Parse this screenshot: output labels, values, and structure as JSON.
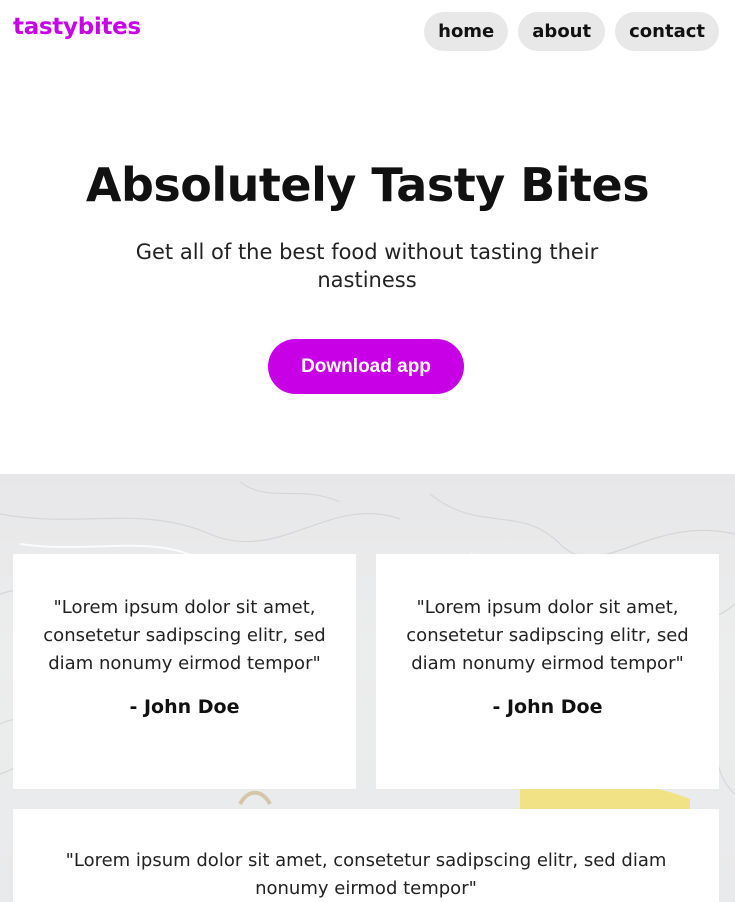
{
  "header": {
    "logo": "tastybites",
    "nav": [
      {
        "label": "home"
      },
      {
        "label": "about"
      },
      {
        "label": "contact"
      }
    ]
  },
  "hero": {
    "title": "Absolutely Tasty Bites",
    "subtitle": "Get all of the best food without tasting their nastiness",
    "cta_label": "Download app"
  },
  "testimonials": [
    {
      "quote": "\"Lorem ipsum dolor sit amet, consetetur sadipscing elitr, sed diam nonumy eirmod tempor\"",
      "author": "- John Doe"
    },
    {
      "quote": "\"Lorem ipsum dolor sit amet, consetetur sadipscing elitr, sed diam nonumy eirmod tempor\"",
      "author": "- John Doe"
    },
    {
      "quote": "\"Lorem ipsum dolor sit amet, consetetur sadipscing elitr, sed diam nonumy eirmod tempor\""
    }
  ],
  "colors": {
    "accent": "#c800e6",
    "nav_bg": "#e8e8e8"
  }
}
